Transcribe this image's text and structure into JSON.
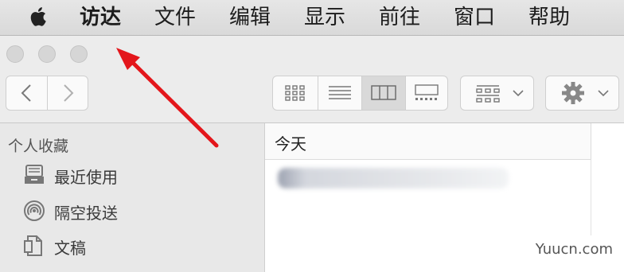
{
  "menubar": {
    "apple_icon": "apple-logo",
    "items": [
      "访达",
      "文件",
      "编辑",
      "显示",
      "前往",
      "窗口",
      "帮助"
    ]
  },
  "window": {
    "traffic_lights": [
      "close",
      "minimize",
      "zoom"
    ],
    "toolbar": {
      "back_icon": "chevron-left",
      "forward_icon": "chevron-right",
      "view_modes": [
        "icon-view",
        "list-view",
        "column-view",
        "gallery-view"
      ],
      "active_view": "column-view",
      "group_icon": "group-grid",
      "action_icon": "gear"
    },
    "sidebar": {
      "section_title": "个人收藏",
      "items": [
        {
          "label": "最近使用",
          "icon": "recents-tray"
        },
        {
          "label": "隔空投送",
          "icon": "airdrop"
        },
        {
          "label": "文稿",
          "icon": "document"
        }
      ]
    },
    "content": {
      "column_header": "今天"
    }
  },
  "watermark": "Yuucn.com",
  "colors": {
    "arrow": "#e3161b",
    "menubar": "#e0e0e0",
    "sidebar": "#e8e8e8"
  }
}
